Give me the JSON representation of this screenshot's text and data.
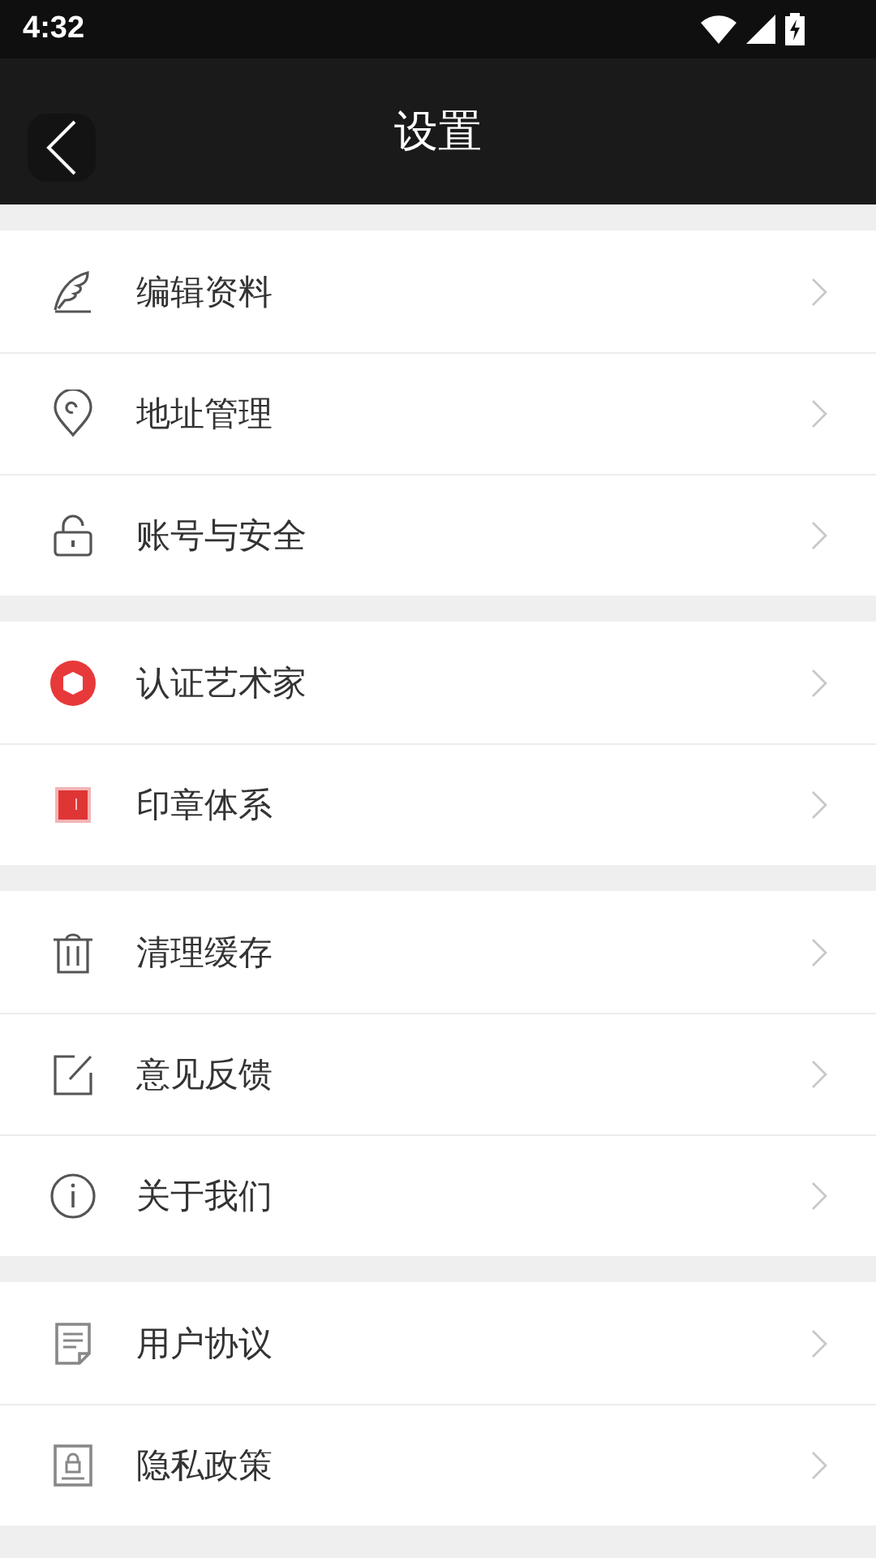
{
  "status_bar": {
    "time": "4:32"
  },
  "header": {
    "title": "设置"
  },
  "groups": [
    {
      "items": [
        {
          "label": "编辑资料"
        },
        {
          "label": "地址管理"
        },
        {
          "label": "账号与安全"
        }
      ]
    },
    {
      "items": [
        {
          "label": "认证艺术家"
        },
        {
          "label": "印章体系"
        }
      ]
    },
    {
      "items": [
        {
          "label": "清理缓存"
        },
        {
          "label": "意见反馈"
        },
        {
          "label": "关于我们"
        }
      ]
    },
    {
      "items": [
        {
          "label": "用户协议"
        },
        {
          "label": "隐私政策"
        }
      ]
    }
  ]
}
